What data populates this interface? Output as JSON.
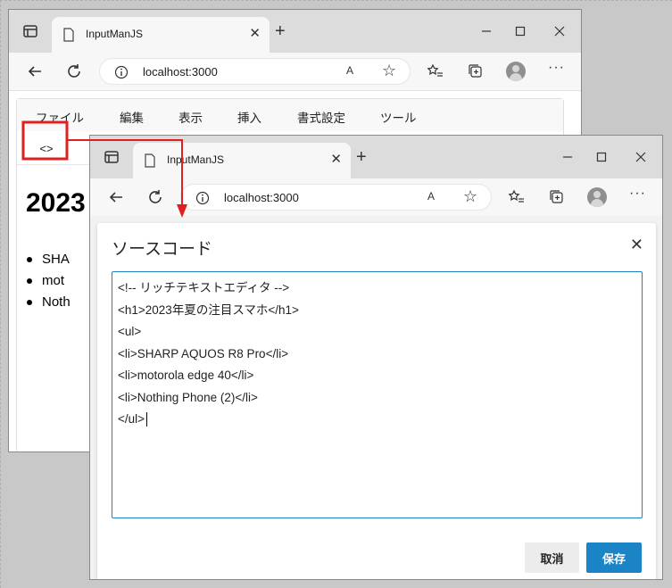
{
  "back_window": {
    "tab_title": "InputManJS",
    "address": "localhost:3000",
    "read_aloud": "A",
    "menu": [
      "ファイル",
      "編集",
      "表示",
      "挿入",
      "書式設定",
      "ツール"
    ],
    "source_button": "<>",
    "doc_heading": "2023",
    "doc_items": [
      "SHA",
      "mot",
      "Noth"
    ]
  },
  "front_window": {
    "tab_title": "InputManJS",
    "address": "localhost:3000",
    "read_aloud": "A",
    "dialog": {
      "title": "ソースコード",
      "close_glyph": "✕",
      "code_lines": [
        "<!-- リッチテキストエディタ -->",
        "<h1>2023年夏の注目スマホ</h1>",
        "<ul>",
        "<li>SHARP AQUOS R8 Pro</li>",
        "<li>motorola edge 40</li>",
        "<li>Nothing Phone (2)</li>",
        "</ul>"
      ],
      "cancel_label": "取消",
      "save_label": "保存"
    }
  },
  "icons": {
    "tab_close": "✕",
    "new_tab": "+",
    "more": "···",
    "favorite": "☆"
  },
  "colors": {
    "highlight_red": "#e02020",
    "accent_blue": "#1b84c6"
  }
}
